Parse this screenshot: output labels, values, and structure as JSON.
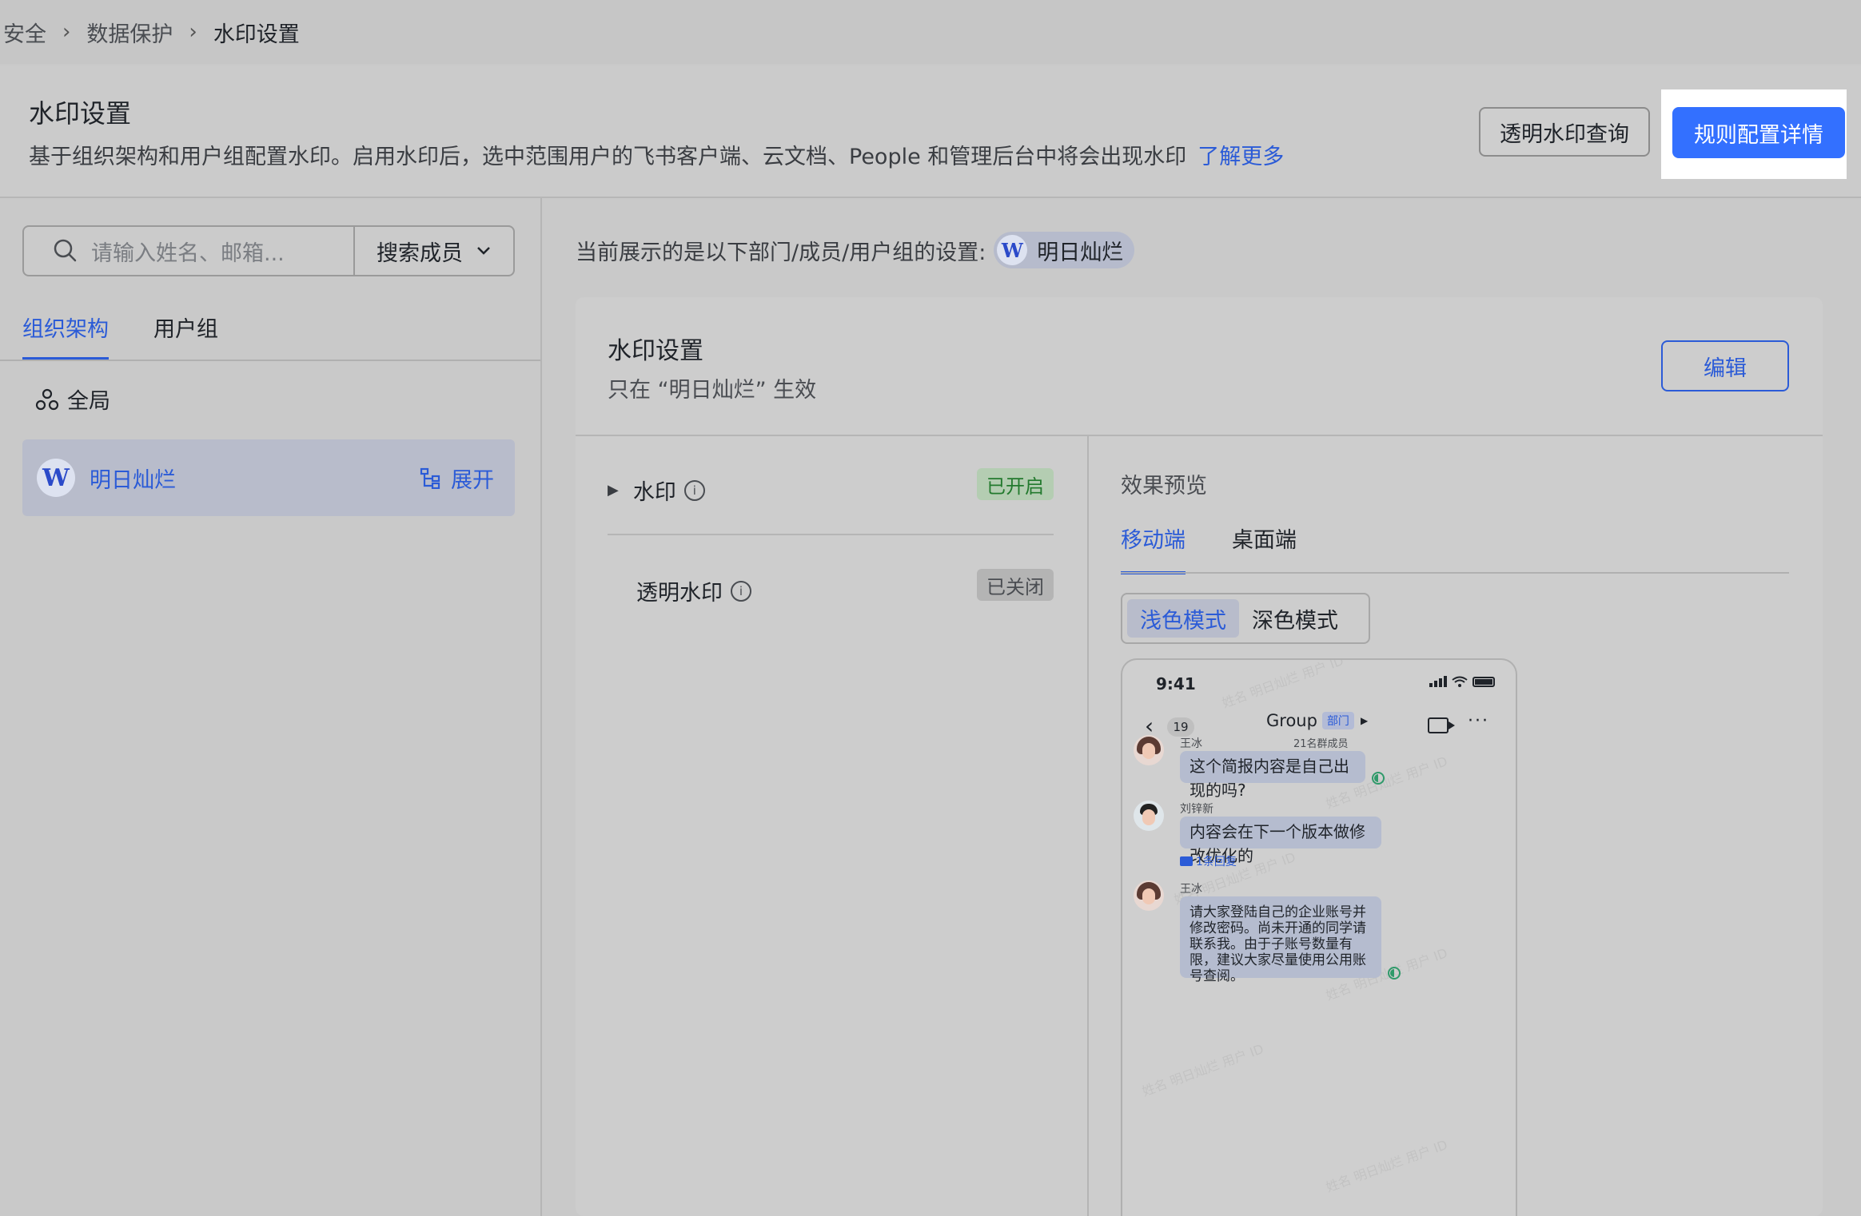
{
  "breadcrumb": [
    "安全",
    "数据保护",
    "水印设置"
  ],
  "header": {
    "title": "水印设置",
    "description": "基于组织架构和用户组配置水印。启用水印后，选中范围用户的飞书客户端、云文档、People 和管理后台中将会出现水印",
    "learn_more": "了解更多",
    "query_button": "透明水印查询",
    "rules_button": "规则配置详情"
  },
  "sidebar": {
    "search_placeholder": "请输入姓名、邮箱...",
    "search_scope": "搜索成员",
    "tabs": [
      "组织架构",
      "用户组"
    ],
    "global_label": "全局",
    "org_name": "明日灿烂",
    "org_logo": "W",
    "expand_label": "展开"
  },
  "main": {
    "scope_text": "当前展示的是以下部门/成员/用户组的设置:",
    "scope_chip": "明日灿烂",
    "card_title": "水印设置",
    "card_sub": "只在 “明日灿烂” 生效",
    "edit_button": "编辑",
    "items": [
      {
        "label": "水印",
        "status": "已开启"
      },
      {
        "label": "透明水印",
        "status": "已关闭"
      }
    ],
    "preview_label": "效果预览",
    "preview_tabs": [
      "移动端",
      "桌面端"
    ],
    "modes": [
      "浅色模式",
      "深色模式"
    ]
  },
  "phone": {
    "time": "9:41",
    "back_count": "19",
    "group_name": "Group",
    "dept_tag": "部门",
    "members": "21名群成员",
    "messages": [
      {
        "sender": "王冰",
        "text": "这个简报内容是自己出现的吗?"
      },
      {
        "sender": "刘锌新",
        "text": "内容会在下一个版本做修改优化的",
        "reply": "1条回复"
      },
      {
        "sender": "王冰",
        "text": "请大家登陆自己的企业账号并修改密码。尚未开通的同学请联系我。由于子账号数量有限，建议大家尽量使用公用账号查阅。"
      }
    ]
  },
  "colors": {
    "accent": "#3370ff",
    "on_badge": "#237a2e"
  }
}
